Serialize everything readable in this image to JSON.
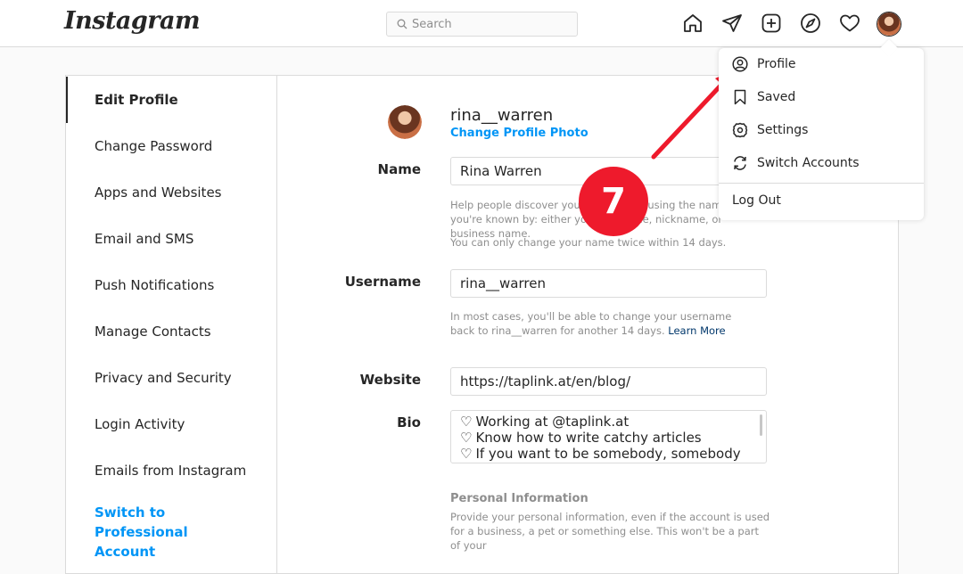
{
  "app": {
    "logo": "Instagram"
  },
  "search": {
    "placeholder": "Search"
  },
  "nav_icons": [
    "home-icon",
    "direct-icon",
    "new-post-icon",
    "explore-icon",
    "activity-heart-icon",
    "profile-avatar"
  ],
  "sidebar": {
    "items": [
      {
        "label": "Edit Profile",
        "active": true
      },
      {
        "label": "Change Password"
      },
      {
        "label": "Apps and Websites"
      },
      {
        "label": "Email and SMS"
      },
      {
        "label": "Push Notifications"
      },
      {
        "label": "Manage Contacts"
      },
      {
        "label": "Privacy and Security"
      },
      {
        "label": "Login Activity"
      },
      {
        "label": "Emails from Instagram"
      }
    ],
    "professional_link": "Switch to Professional Account"
  },
  "profile": {
    "username": "rina__warren",
    "change_photo_label": "Change Profile Photo"
  },
  "form": {
    "name": {
      "label": "Name",
      "value": "Rina Warren",
      "help_1": "Help people discover your account by using the name you're known by: either your full name, nickname, or business name.",
      "help_2": "You can only change your name twice within 14 days."
    },
    "username": {
      "label": "Username",
      "value": "rina__warren",
      "help": "In most cases, you'll be able to change your username back to rina__warren for another 14 days.",
      "learn_more": "Learn More"
    },
    "website": {
      "label": "Website",
      "value": "https://taplink.at/en/blog/"
    },
    "bio": {
      "label": "Bio",
      "lines": [
        "Working at @taplink.at",
        "Know how to write catchy articles",
        "If you want to be somebody, somebody"
      ]
    },
    "personal_info": {
      "heading": "Personal Information",
      "text": "Provide your personal information, even if the account is used for a business, a pet or something else. This won't be a part of your"
    }
  },
  "dropdown": {
    "items": [
      {
        "label": "Profile",
        "icon": "user-circle-icon"
      },
      {
        "label": "Saved",
        "icon": "bookmark-icon"
      },
      {
        "label": "Settings",
        "icon": "gear-icon"
      },
      {
        "label": "Switch Accounts",
        "icon": "switch-arrows-icon"
      }
    ],
    "logout": "Log Out"
  },
  "annotation": {
    "step": "7",
    "color": "#ee1a2c"
  },
  "colors": {
    "link": "#0095f6",
    "border": "#dbdbdb",
    "text": "#262626",
    "muted": "#8e8e8e"
  }
}
